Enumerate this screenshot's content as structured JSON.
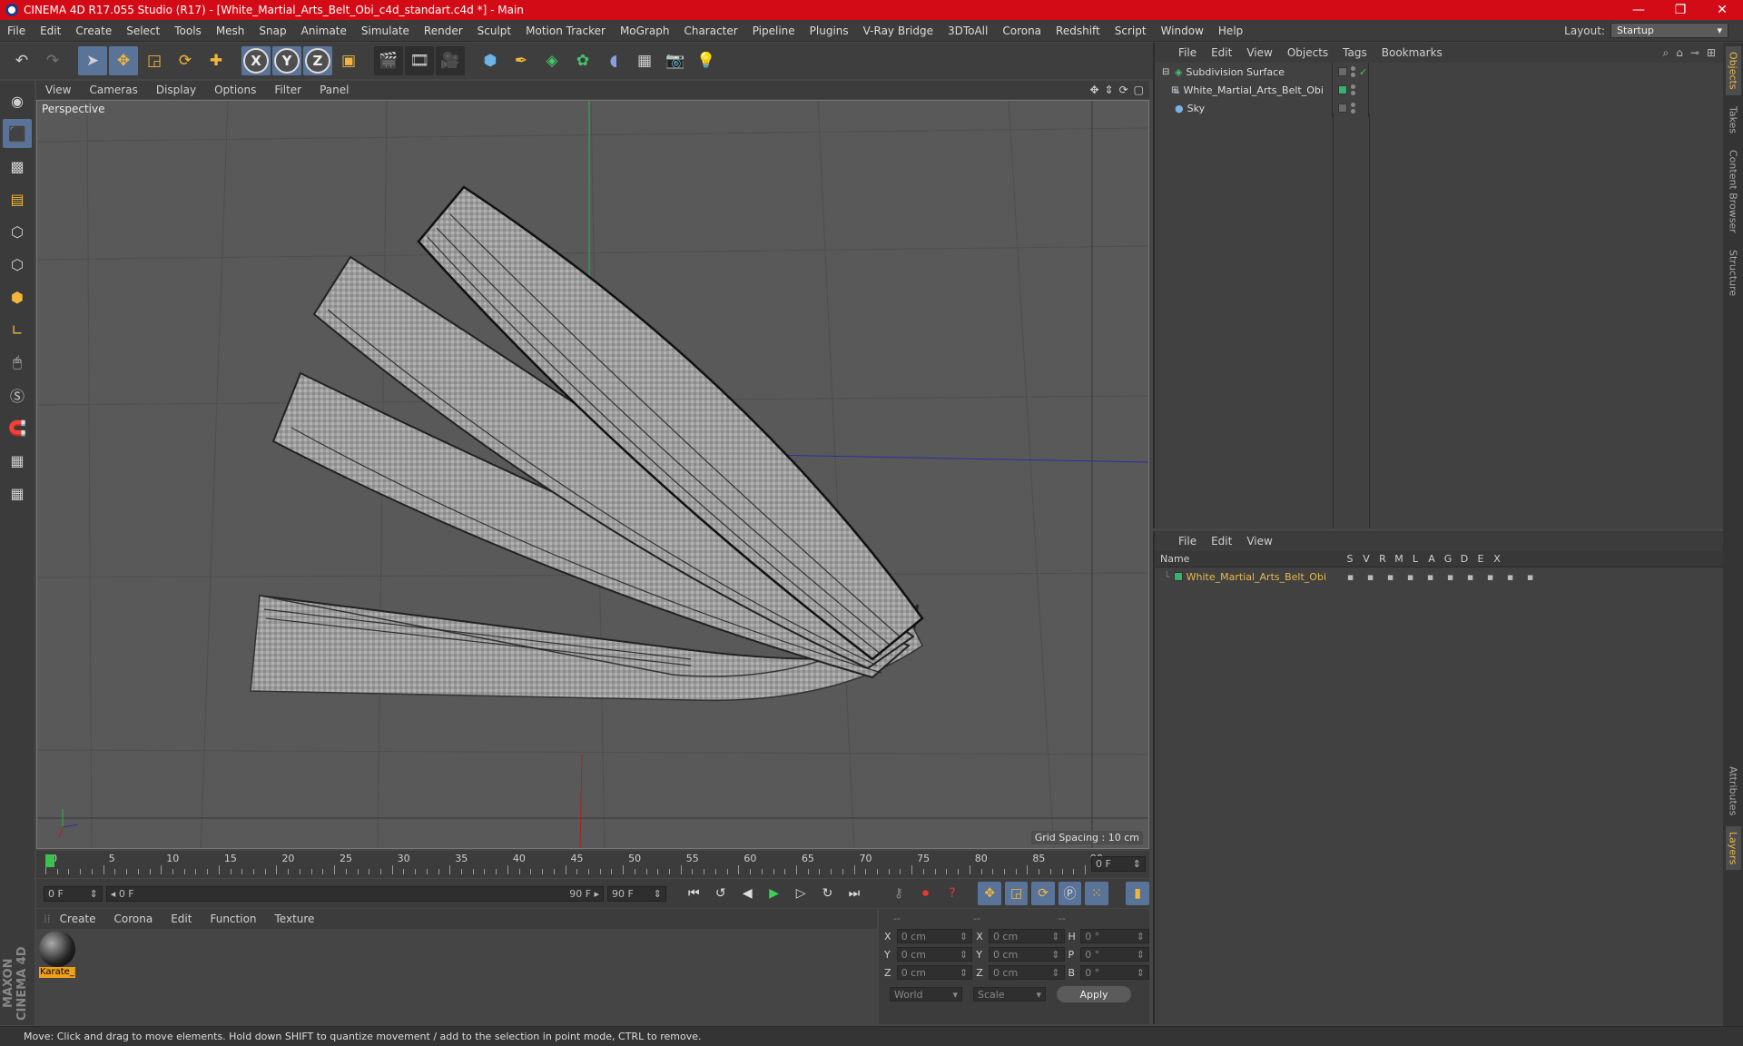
{
  "window": {
    "title": "CINEMA 4D R17.055 Studio (R17) - [White_Martial_Arts_Belt_Obi_c4d_standart.c4d *] - Main",
    "minimize": "—",
    "maximize": "❐",
    "close": "✕"
  },
  "menubar": {
    "items": [
      "File",
      "Edit",
      "Create",
      "Select",
      "Tools",
      "Mesh",
      "Snap",
      "Animate",
      "Simulate",
      "Render",
      "Sculpt",
      "Motion Tracker",
      "MoGraph",
      "Character",
      "Pipeline",
      "Plugins",
      "V-Ray Bridge",
      "3DToAll",
      "Corona",
      "Redshift",
      "Script",
      "Window",
      "Help"
    ],
    "layout_label": "Layout:",
    "layout_value": "Startup"
  },
  "viewport": {
    "menu": [
      "View",
      "Cameras",
      "Display",
      "Options",
      "Filter",
      "Panel"
    ],
    "label": "Perspective",
    "grid_spacing": "Grid Spacing : 10 cm",
    "axis_y": "Y",
    "axis_z": "Z",
    "axis_x": "X"
  },
  "timeline": {
    "ticks": [
      "0",
      "5",
      "10",
      "15",
      "20",
      "25",
      "30",
      "35",
      "40",
      "45",
      "50",
      "55",
      "60",
      "65",
      "70",
      "75",
      "80",
      "85",
      "90"
    ],
    "current_frame": "0 F",
    "start_field": "0 F",
    "range_start": "◂ 0 F",
    "range_end": "90 F ▸",
    "end_field": "90 F"
  },
  "material_manager": {
    "menu": [
      "Create",
      "Corona",
      "Edit",
      "Function",
      "Texture"
    ],
    "material_name": "Karate_E"
  },
  "coordinates": {
    "header": [
      "--",
      "--",
      "--"
    ],
    "rows": [
      {
        "a": "X",
        "v1": "0 cm",
        "b": "X",
        "v2": "0 cm",
        "c": "H",
        "v3": "0 °"
      },
      {
        "a": "Y",
        "v1": "0 cm",
        "b": "Y",
        "v2": "0 cm",
        "c": "P",
        "v3": "0 °"
      },
      {
        "a": "Z",
        "v1": "0 cm",
        "b": "Z",
        "v2": "0 cm",
        "c": "B",
        "v3": "0 °"
      }
    ],
    "mode1": "World",
    "mode2": "Scale",
    "apply": "Apply"
  },
  "object_manager": {
    "menu": [
      "File",
      "Edit",
      "View",
      "Objects",
      "Tags",
      "Bookmarks"
    ],
    "objects": [
      {
        "name": "Subdivision Surface",
        "check": "✓"
      },
      {
        "name": "White_Martial_Arts_Belt_Obi",
        "check": ""
      },
      {
        "name": "Sky",
        "check": ""
      }
    ]
  },
  "layer_manager": {
    "menu": [
      "File",
      "Edit",
      "View"
    ],
    "columns": [
      "Name",
      "S",
      "V",
      "R",
      "M",
      "L",
      "A",
      "G",
      "D",
      "E",
      "X"
    ],
    "layers": [
      {
        "name": "White_Martial_Arts_Belt_Obi"
      }
    ],
    "layer_color": "#34b36e"
  },
  "right_tabs": [
    "Objects",
    "Takes",
    "Content Browser",
    "Structure",
    "Attributes",
    "Layers"
  ],
  "status": "Move: Click and drag to move elements. Hold down SHIFT to quantize movement / add to the selection in point mode, CTRL to remove.",
  "maxon_logo": "MAXON CINEMA 4D",
  "colors": {
    "title_bar": "#d30b16",
    "accent": "#5a7398",
    "highlight": "#e9b84a"
  }
}
